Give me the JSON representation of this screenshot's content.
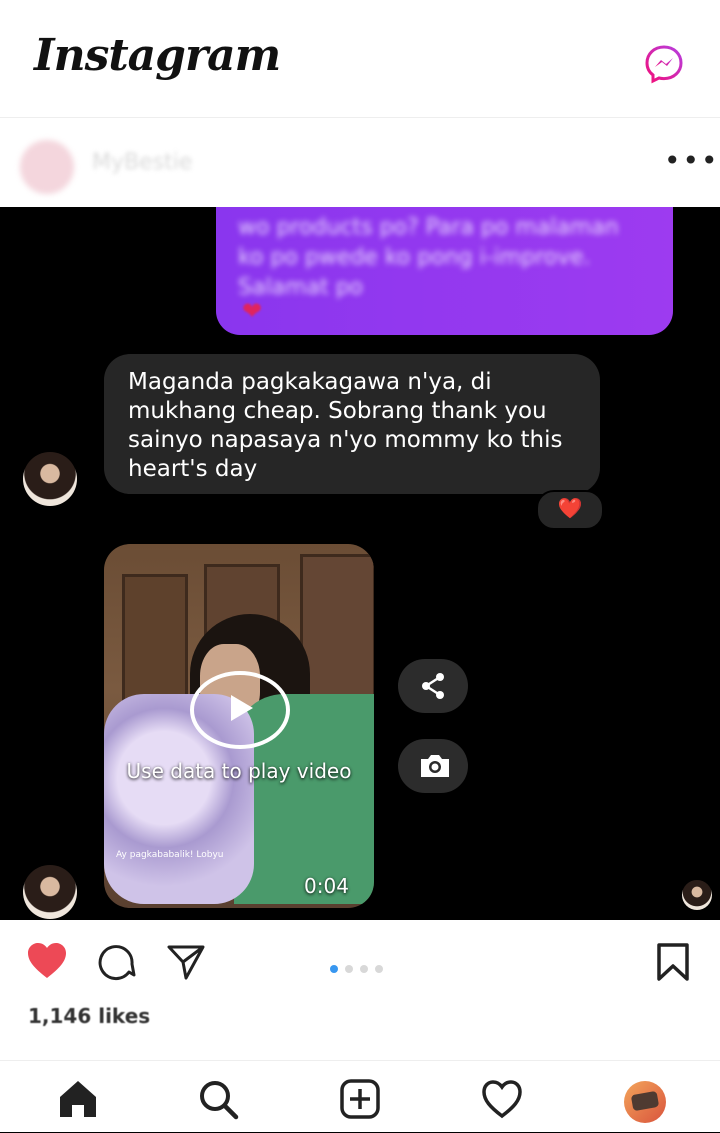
{
  "header": {
    "app_title": "Instagram",
    "messenger_icon": "messenger-icon"
  },
  "post": {
    "username": "MyBestie",
    "more_icon": "more-horizontal-icon"
  },
  "chat": {
    "sent_message_blurred": "wo products po? Para po malaman ko po pwede ko pong i-improve. Salamat po",
    "received_message": "Maganda pagkakagawa n'ya, di mukhang cheap. Sobrang thank you sainyo napasaya n'yo mommy ko this heart's day",
    "reaction": "❤️",
    "video": {
      "overlay_text": "Use data to play video",
      "duration": "0:04",
      "caption": "Ay pagkababalik! Lobyu"
    },
    "share_icon": "share-icon",
    "camera_icon": "camera-icon"
  },
  "post_actions": {
    "likes": "1,146 likes",
    "carousel_total": 4,
    "carousel_active": 1,
    "colors": {
      "like": "#ed4956",
      "carousel_active": "#3897f0"
    }
  },
  "bottom_nav": {
    "items": [
      "home-icon",
      "search-icon",
      "new-post-icon",
      "activity-icon",
      "profile-icon"
    ]
  }
}
